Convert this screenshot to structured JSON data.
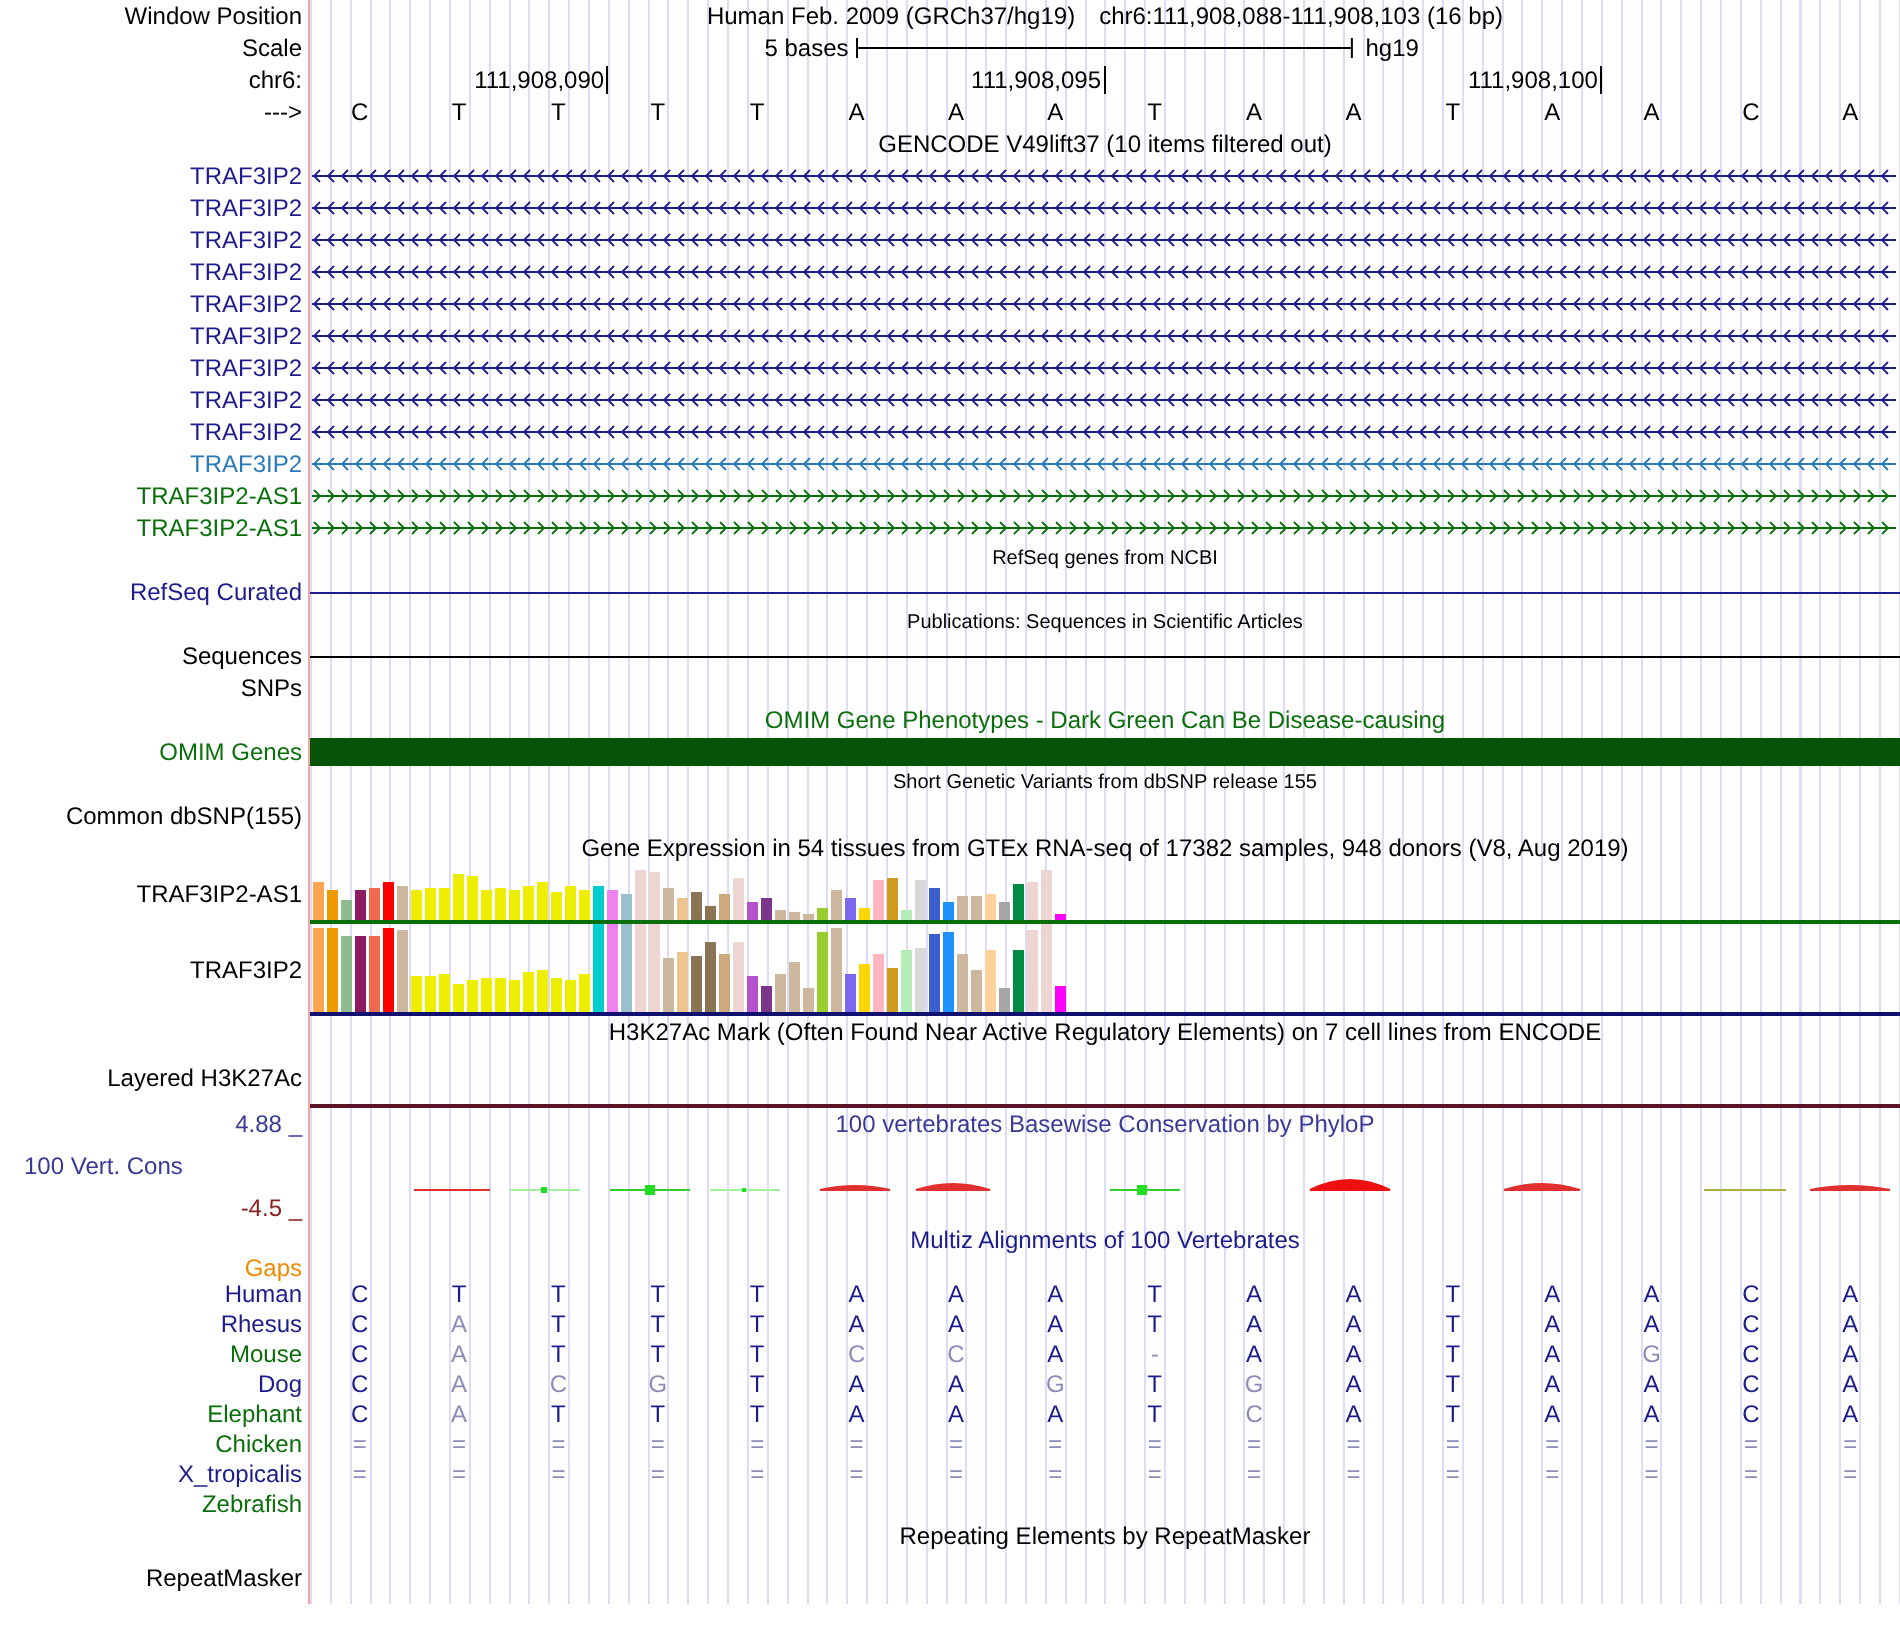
{
  "ruler": {
    "window_position_label": "Window Position",
    "assembly": "Human Feb. 2009 (GRCh37/hg19)",
    "position": "chr6:111,908,088-111,908,103 (16 bp)",
    "scale_label": "Scale",
    "scale_text": "5 bases",
    "scale_assembly": "hg19",
    "chrom_label": "chr6:",
    "ticks": [
      "111,908,090",
      "111,908,095",
      "111,908,100"
    ],
    "strand_label": "--->",
    "bases": [
      "C",
      "T",
      "T",
      "T",
      "T",
      "A",
      "A",
      "A",
      "T",
      "A",
      "A",
      "T",
      "A",
      "A",
      "C",
      "A"
    ]
  },
  "gencode": {
    "title": "GENCODE V49lift37 (10 items filtered out)",
    "genes": [
      {
        "label": "TRAF3IP2",
        "color": "#1c1c8c",
        "kind": "minus"
      },
      {
        "label": "TRAF3IP2",
        "color": "#1c1c8c",
        "kind": "minus"
      },
      {
        "label": "TRAF3IP2",
        "color": "#1c1c8c",
        "kind": "minus"
      },
      {
        "label": "TRAF3IP2",
        "color": "#1c1c8c",
        "kind": "minus"
      },
      {
        "label": "TRAF3IP2",
        "color": "#1c1c8c",
        "kind": "minus"
      },
      {
        "label": "TRAF3IP2",
        "color": "#1c1c8c",
        "kind": "minus"
      },
      {
        "label": "TRAF3IP2",
        "color": "#1c1c8c",
        "kind": "minus"
      },
      {
        "label": "TRAF3IP2",
        "color": "#1c1c8c",
        "kind": "minus"
      },
      {
        "label": "TRAF3IP2",
        "color": "#1c1c8c",
        "kind": "minus"
      },
      {
        "label": "TRAF3IP2",
        "color": "#2a7ab8",
        "kind": "minus"
      },
      {
        "label": "TRAF3IP2-AS1",
        "color": "#0a6e0a",
        "kind": "plus"
      },
      {
        "label": "TRAF3IP2-AS1",
        "color": "#0a6e0a",
        "kind": "plus"
      }
    ]
  },
  "refseq": {
    "title": "RefSeq genes from NCBI",
    "label": "RefSeq Curated"
  },
  "publications": {
    "title": "Publications: Sequences in Scientific Articles",
    "label": "Sequences"
  },
  "snps": {
    "label": "SNPs"
  },
  "omim": {
    "title": "OMIM Gene Phenotypes - Dark Green Can Be Disease-causing",
    "label": "OMIM Genes"
  },
  "dbsnp": {
    "title": "Short Genetic Variants from dbSNP release 155",
    "label": "Common dbSNP(155)"
  },
  "gtex": {
    "title": "Gene Expression in 54 tissues from GTEx RNA-seq of 17382 samples, 948 donors (V8, Aug 2019)",
    "rows": [
      {
        "label": "TRAF3IP2-AS1",
        "color": "#0a6e0a"
      },
      {
        "label": "TRAF3IP2",
        "color": "#10106e"
      }
    ]
  },
  "h3k27ac": {
    "title": "H3K27Ac Mark (Often Found Near Active Regulatory Elements) on 7 cell lines from ENCODE",
    "label": "Layered H3K27Ac"
  },
  "phylop": {
    "title": "100 vertebrates Basewise Conservation by PhyloP",
    "label": "100 Vert. Cons",
    "max_label": "4.88 _",
    "min_label": "-4.5 _"
  },
  "multiz": {
    "title": "Multiz Alignments of 100 Vertebrates",
    "gaps_label": "Gaps",
    "species": [
      {
        "name": "Human",
        "color": "#1c1c8c",
        "bases": [
          {
            "b": "C",
            "match": true
          },
          {
            "b": "T",
            "match": true
          },
          {
            "b": "T",
            "match": true
          },
          {
            "b": "T",
            "match": true
          },
          {
            "b": "T",
            "match": true
          },
          {
            "b": "A",
            "match": true
          },
          {
            "b": "A",
            "match": true
          },
          {
            "b": "A",
            "match": true
          },
          {
            "b": "T",
            "match": true
          },
          {
            "b": "A",
            "match": true
          },
          {
            "b": "A",
            "match": true
          },
          {
            "b": "T",
            "match": true
          },
          {
            "b": "A",
            "match": true
          },
          {
            "b": "A",
            "match": true
          },
          {
            "b": "C",
            "match": true
          },
          {
            "b": "A",
            "match": true
          }
        ]
      },
      {
        "name": "Rhesus",
        "color": "#1c1c8c",
        "bases": [
          {
            "b": "C",
            "match": true
          },
          {
            "b": "A",
            "match": false
          },
          {
            "b": "T",
            "match": true
          },
          {
            "b": "T",
            "match": true
          },
          {
            "b": "T",
            "match": true
          },
          {
            "b": "A",
            "match": true
          },
          {
            "b": "A",
            "match": true
          },
          {
            "b": "A",
            "match": true
          },
          {
            "b": "T",
            "match": true
          },
          {
            "b": "A",
            "match": true
          },
          {
            "b": "A",
            "match": true
          },
          {
            "b": "T",
            "match": true
          },
          {
            "b": "A",
            "match": true
          },
          {
            "b": "A",
            "match": true
          },
          {
            "b": "C",
            "match": true
          },
          {
            "b": "A",
            "match": true
          }
        ]
      },
      {
        "name": "Mouse",
        "color": "#0a6e0a",
        "bases": [
          {
            "b": "C",
            "match": true
          },
          {
            "b": "A",
            "match": false
          },
          {
            "b": "T",
            "match": true
          },
          {
            "b": "T",
            "match": true
          },
          {
            "b": "T",
            "match": true
          },
          {
            "b": "C",
            "match": false
          },
          {
            "b": "C",
            "match": false
          },
          {
            "b": "A",
            "match": true
          },
          {
            "b": "-",
            "match": false
          },
          {
            "b": "A",
            "match": true
          },
          {
            "b": "A",
            "match": true
          },
          {
            "b": "T",
            "match": true
          },
          {
            "b": "A",
            "match": true
          },
          {
            "b": "G",
            "match": false
          },
          {
            "b": "C",
            "match": true
          },
          {
            "b": "A",
            "match": true
          }
        ]
      },
      {
        "name": "Dog",
        "color": "#1c1c8c",
        "bases": [
          {
            "b": "C",
            "match": true
          },
          {
            "b": "A",
            "match": false
          },
          {
            "b": "C",
            "match": false
          },
          {
            "b": "G",
            "match": false
          },
          {
            "b": "T",
            "match": true
          },
          {
            "b": "A",
            "match": true
          },
          {
            "b": "A",
            "match": true
          },
          {
            "b": "G",
            "match": false
          },
          {
            "b": "T",
            "match": true
          },
          {
            "b": "G",
            "match": false
          },
          {
            "b": "A",
            "match": true
          },
          {
            "b": "T",
            "match": true
          },
          {
            "b": "A",
            "match": true
          },
          {
            "b": "A",
            "match": true
          },
          {
            "b": "C",
            "match": true
          },
          {
            "b": "A",
            "match": true
          }
        ]
      },
      {
        "name": "Elephant",
        "color": "#0a6e0a",
        "bases": [
          {
            "b": "C",
            "match": true
          },
          {
            "b": "A",
            "match": false
          },
          {
            "b": "T",
            "match": true
          },
          {
            "b": "T",
            "match": true
          },
          {
            "b": "T",
            "match": true
          },
          {
            "b": "A",
            "match": true
          },
          {
            "b": "A",
            "match": true
          },
          {
            "b": "A",
            "match": true
          },
          {
            "b": "T",
            "match": true
          },
          {
            "b": "C",
            "match": false
          },
          {
            "b": "A",
            "match": true
          },
          {
            "b": "T",
            "match": true
          },
          {
            "b": "A",
            "match": true
          },
          {
            "b": "A",
            "match": true
          },
          {
            "b": "C",
            "match": true
          },
          {
            "b": "A",
            "match": true
          }
        ]
      },
      {
        "name": "Chicken",
        "color": "#0a6e0a",
        "bases": [
          {
            "b": "=",
            "match": false
          },
          {
            "b": "=",
            "match": false
          },
          {
            "b": "=",
            "match": false
          },
          {
            "b": "=",
            "match": false
          },
          {
            "b": "=",
            "match": false
          },
          {
            "b": "=",
            "match": false
          },
          {
            "b": "=",
            "match": false
          },
          {
            "b": "=",
            "match": false
          },
          {
            "b": "=",
            "match": false
          },
          {
            "b": "=",
            "match": false
          },
          {
            "b": "=",
            "match": false
          },
          {
            "b": "=",
            "match": false
          },
          {
            "b": "=",
            "match": false
          },
          {
            "b": "=",
            "match": false
          },
          {
            "b": "=",
            "match": false
          },
          {
            "b": "=",
            "match": false
          }
        ]
      },
      {
        "name": "X_tropicalis",
        "color": "#1c1c8c",
        "bases": [
          {
            "b": "=",
            "match": false
          },
          {
            "b": "=",
            "match": false
          },
          {
            "b": "=",
            "match": false
          },
          {
            "b": "=",
            "match": false
          },
          {
            "b": "=",
            "match": false
          },
          {
            "b": "=",
            "match": false
          },
          {
            "b": "=",
            "match": false
          },
          {
            "b": "=",
            "match": false
          },
          {
            "b": "=",
            "match": false
          },
          {
            "b": "=",
            "match": false
          },
          {
            "b": "=",
            "match": false
          },
          {
            "b": "=",
            "match": false
          },
          {
            "b": "=",
            "match": false
          },
          {
            "b": "=",
            "match": false
          },
          {
            "b": "=",
            "match": false
          },
          {
            "b": "=",
            "match": false
          }
        ]
      },
      {
        "name": "Zebrafish",
        "color": "#0a6e0a"
      }
    ]
  },
  "repeatmasker": {
    "title": "Repeating Elements by RepeatMasker",
    "label": "RepeatMasker"
  }
}
